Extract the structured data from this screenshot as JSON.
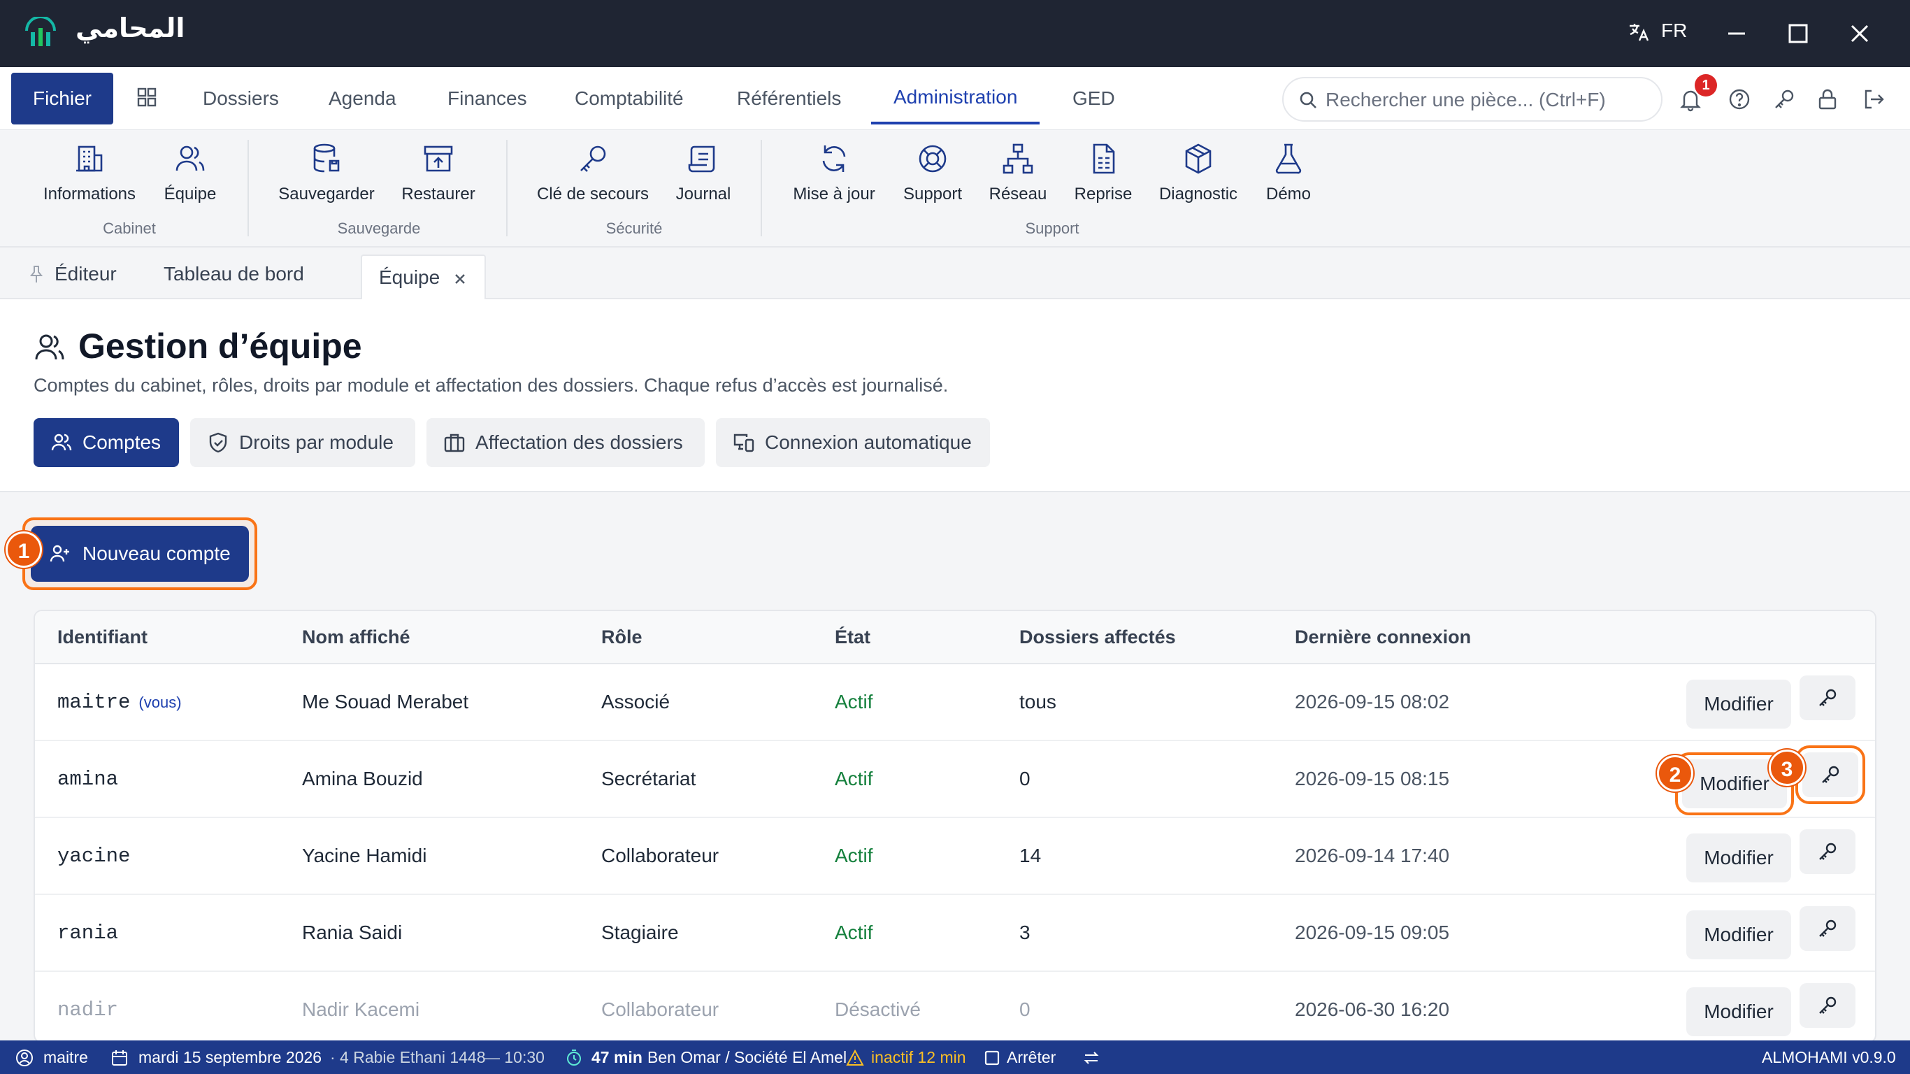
{
  "app": {
    "name": "المحامي",
    "lang": "FR"
  },
  "menu": {
    "fichier": "Fichier",
    "items": [
      "Dossiers",
      "Agenda",
      "Finances",
      "Comptabilité",
      "Référentiels",
      "Administration",
      "GED"
    ],
    "active": "Administration"
  },
  "search": {
    "placeholder": "Rechercher une pièce... (Ctrl+F)"
  },
  "notifications": {
    "count": "1"
  },
  "ribbon": {
    "groups": [
      "Cabinet",
      "Sauvegarde",
      "Sécurité",
      "Support"
    ],
    "buttons": {
      "informations": "Informations",
      "equipe": "Équipe",
      "sauvegarder": "Sauvegarder",
      "restaurer": "Restaurer",
      "cle": "Clé de secours",
      "journal": "Journal",
      "maj": "Mise à jour",
      "support": "Support",
      "reseau": "Réseau",
      "reprise": "Reprise",
      "diagnostic": "Diagnostic",
      "demo": "Démo"
    }
  },
  "tabs": {
    "editeur": "Éditeur",
    "tableau": "Tableau de bord",
    "equipe": "Équipe"
  },
  "page": {
    "title": "Gestion d’équipe",
    "description": "Comptes du cabinet, rôles, droits par module et affectation des dossiers. Chaque refus d’accès est journalisé.",
    "subtabs": [
      "Comptes",
      "Droits par module",
      "Affectation des dossiers",
      "Connexion automatique"
    ],
    "new_account": "Nouveau compte"
  },
  "markers": [
    "1",
    "2",
    "3"
  ],
  "table": {
    "headers": [
      "Identifiant",
      "Nom affiché",
      "Rôle",
      "État",
      "Dossiers affectés",
      "Dernière connexion"
    ],
    "you_label": "(vous)",
    "modify_label": "Modifier",
    "rows": [
      {
        "id": "maitre",
        "name": "Me Souad Merabet",
        "role": "Associé",
        "state": "Actif",
        "folders": "tous",
        "last": "2026-09-15 08:02"
      },
      {
        "id": "amina",
        "name": "Amina Bouzid",
        "role": "Secrétariat",
        "state": "Actif",
        "folders": "0",
        "last": "2026-09-15 08:15"
      },
      {
        "id": "yacine",
        "name": "Yacine Hamidi",
        "role": "Collaborateur",
        "state": "Actif",
        "folders": "14",
        "last": "2026-09-14 17:40"
      },
      {
        "id": "rania",
        "name": "Rania Saidi",
        "role": "Stagiaire",
        "state": "Actif",
        "folders": "3",
        "last": "2026-09-15 09:05"
      },
      {
        "id": "nadir",
        "name": "Nadir Kacemi",
        "role": "Collaborateur",
        "state": "Désactivé",
        "folders": "0",
        "last": "2026-06-30 16:20"
      }
    ]
  },
  "status": {
    "user": "maitre",
    "date": "mardi 15 septembre 2026",
    "hijri": "· 4 Rabie Ethani 1448",
    "time": "— 10:30",
    "timer": "47 min",
    "client": "Ben Omar / Société El Amel",
    "inactive": "inactif 12 min",
    "stop": "Arrêter",
    "version": "ALMOHAMI v0.9.0"
  }
}
